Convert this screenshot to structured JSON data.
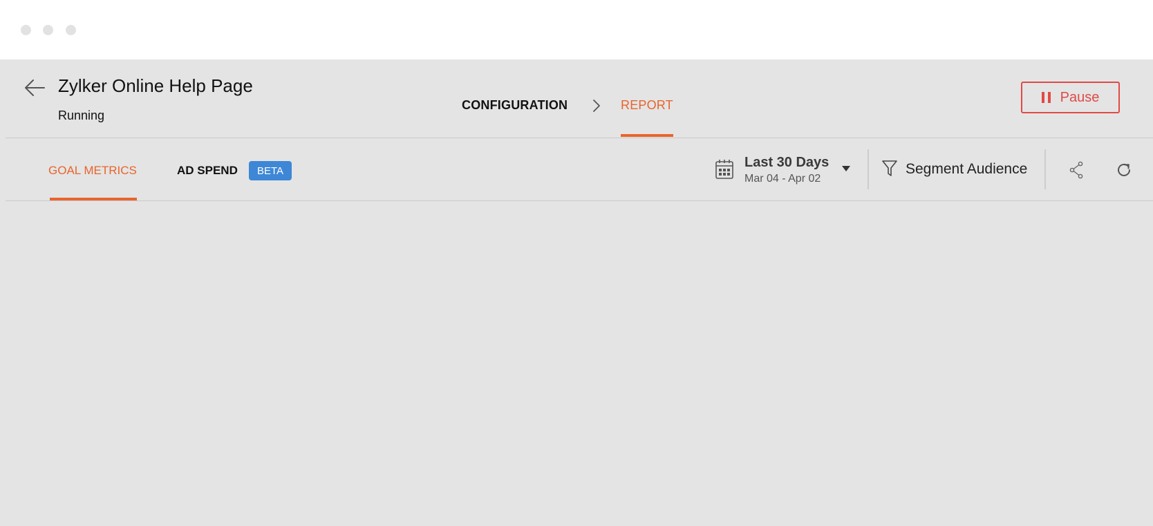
{
  "window": {
    "controls": [
      "close-dot",
      "minimize-dot",
      "maximize-dot"
    ]
  },
  "header": {
    "back_icon": "arrow-left-icon",
    "title": "Zylker Online Help Page",
    "status": "Running",
    "steps": {
      "configuration": "CONFIGURATION",
      "separator_icon": "chevron-right-icon",
      "report": "REPORT",
      "active": "REPORT"
    },
    "pause_button": {
      "label": "Pause",
      "icon": "pause-icon"
    }
  },
  "tabs": {
    "goal_metrics": "GOAL METRICS",
    "ad_spend": "AD SPEND",
    "ad_spend_badge": "BETA",
    "active": "GOAL METRICS"
  },
  "toolbar": {
    "date_range": {
      "icon": "calendar-icon",
      "label": "Last 30 Days",
      "range": "Mar 04 - Apr 02",
      "dropdown_icon": "caret-down-icon"
    },
    "segment": {
      "icon": "filter-icon",
      "label": "Segment Audience"
    },
    "share_icon": "share-icon",
    "refresh_icon": "refresh-icon"
  },
  "colors": {
    "accent": "#e8642c",
    "pause": "#e04a46",
    "beta_badge": "#3d87d6",
    "background": "#e4e4e4",
    "titlebar": "#ffffff"
  }
}
